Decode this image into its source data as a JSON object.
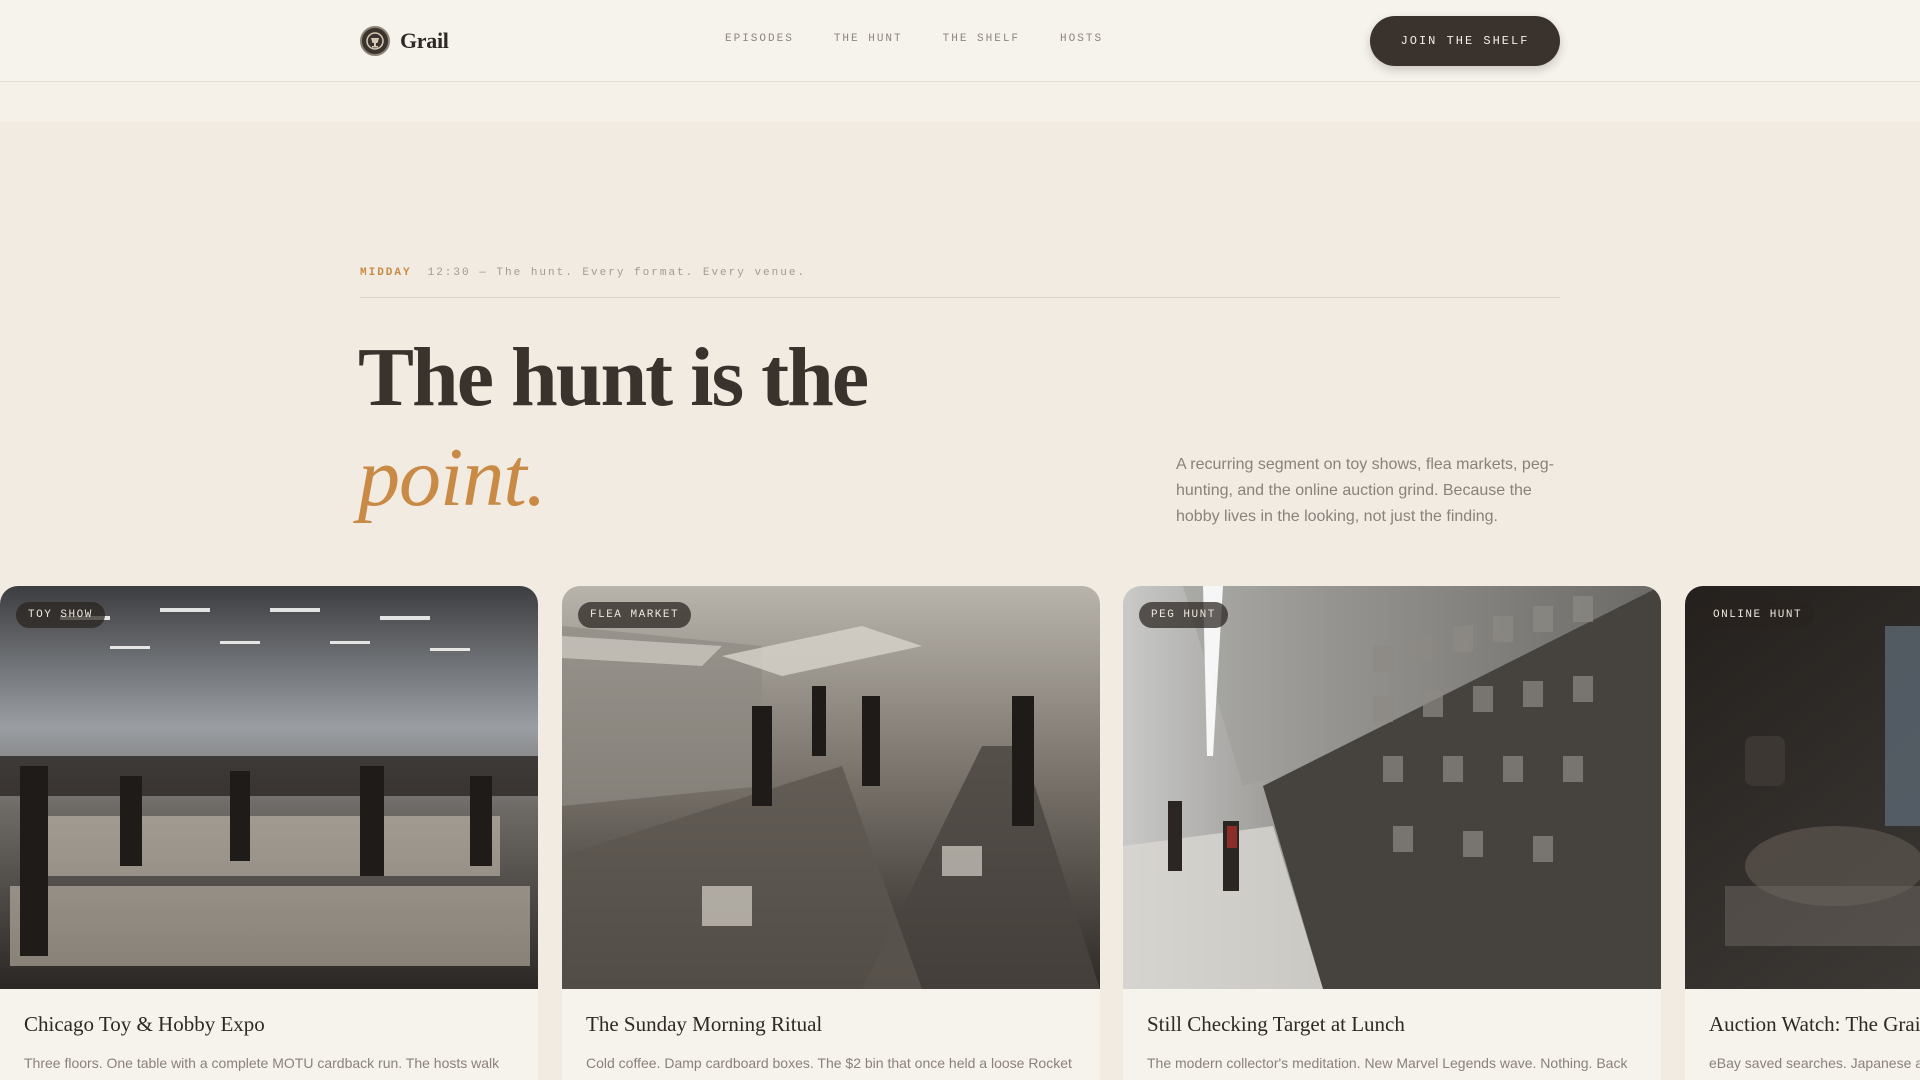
{
  "header": {
    "brand": "Grail",
    "nav": [
      "EPISODES",
      "THE HUNT",
      "THE SHELF",
      "HOSTS"
    ],
    "cta_label": "JOIN THE SHELF"
  },
  "hero": {
    "eyebrow_tag": "MIDDAY",
    "eyebrow_text": "12:30 — The hunt. Every format. Every venue.",
    "headline_line1": "The hunt is the",
    "headline_line2": "point.",
    "lede": "A recurring segment on toy shows, flea markets, peg-hunting, and the online auction grind. Because the hobby lives in the looking, not just the finding."
  },
  "cards": [
    {
      "tag": "TOY SHOW",
      "title": "Chicago Toy & Hobby Expo",
      "desc": "Three floors. One table with a complete MOTU cardback run. The hosts walk"
    },
    {
      "tag": "FLEA MARKET",
      "title": "The Sunday Morning Ritual",
      "desc": "Cold coffee. Damp cardboard boxes. The $2 bin that once held a loose Rocket"
    },
    {
      "tag": "PEG HUNT",
      "title": "Still Checking Target at Lunch",
      "desc": "The modern collector's meditation. New Marvel Legends wave. Nothing. Back"
    },
    {
      "tag": "ONLINE HUNT",
      "title": "Auction Watch: The Grail",
      "desc": "eBay saved searches. Japanese a"
    }
  ],
  "colors": {
    "accent": "#c98a45",
    "ink": "#3a322d",
    "background": "#f1ebe2"
  }
}
